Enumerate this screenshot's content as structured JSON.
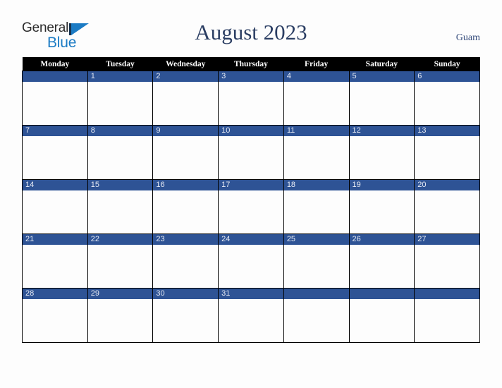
{
  "brand": {
    "line1": "General",
    "line2": "Blue",
    "triangle_color": "#1b7bc4",
    "text_color": "#2b2b2b"
  },
  "header": {
    "title": "August 2023",
    "location": "Guam",
    "title_color": "#2b3e63"
  },
  "calendar": {
    "weekdays": [
      "Monday",
      "Tuesday",
      "Wednesday",
      "Thursday",
      "Friday",
      "Saturday",
      "Sunday"
    ],
    "header_bg": "#000000",
    "banner_bg": "#2e5395",
    "weeks": [
      [
        {
          "date": ""
        },
        {
          "date": "1"
        },
        {
          "date": "2"
        },
        {
          "date": "3"
        },
        {
          "date": "4"
        },
        {
          "date": "5"
        },
        {
          "date": "6"
        }
      ],
      [
        {
          "date": "7"
        },
        {
          "date": "8"
        },
        {
          "date": "9"
        },
        {
          "date": "10"
        },
        {
          "date": "11"
        },
        {
          "date": "12"
        },
        {
          "date": "13"
        }
      ],
      [
        {
          "date": "14"
        },
        {
          "date": "15"
        },
        {
          "date": "16"
        },
        {
          "date": "17"
        },
        {
          "date": "18"
        },
        {
          "date": "19"
        },
        {
          "date": "20"
        }
      ],
      [
        {
          "date": "21"
        },
        {
          "date": "22"
        },
        {
          "date": "23"
        },
        {
          "date": "24"
        },
        {
          "date": "25"
        },
        {
          "date": "26"
        },
        {
          "date": "27"
        }
      ],
      [
        {
          "date": "28"
        },
        {
          "date": "29"
        },
        {
          "date": "30"
        },
        {
          "date": "31"
        },
        {
          "date": ""
        },
        {
          "date": ""
        },
        {
          "date": ""
        }
      ]
    ]
  }
}
